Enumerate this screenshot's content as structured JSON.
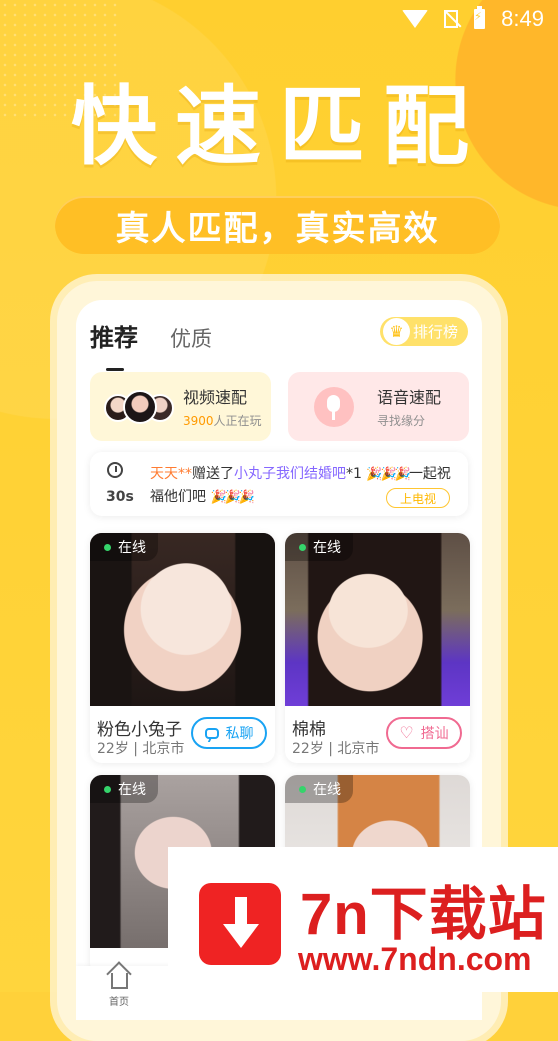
{
  "status_bar": {
    "time": "8:49",
    "wifi_icon": "wifi-icon",
    "sim_icon": "no-sim-icon",
    "battery_icon": "battery-charging-icon"
  },
  "hero": {
    "title": "快速匹配",
    "subtitle": "真人匹配，真实高效"
  },
  "tabs": [
    {
      "label": "推荐",
      "active": true
    },
    {
      "label": "优质",
      "active": false
    }
  ],
  "rank_button": {
    "label": "排行榜",
    "icon": "trophy-icon"
  },
  "match_cards": [
    {
      "title": "视频速配",
      "highlight": "3900",
      "subtitle": "人正在玩",
      "icon": "avatar-group-icon"
    },
    {
      "title": "语音速配",
      "subtitle": "寻找缘分",
      "icon": "microphone-icon"
    }
  ],
  "gift_notice": {
    "timer": "30s",
    "name": "天天**",
    "sent": "赠送了",
    "recipient": "小丸子我们结婚吧",
    "count": "*1",
    "party": "🎉🎉🎉",
    "end": "一起祝",
    "line2_text": "福他们吧",
    "line2_party": "🎉🎉🎉",
    "button": "上电视"
  },
  "users": [
    {
      "name": "粉色小兔子",
      "meta": "22岁 | 北京市",
      "status": "在线",
      "button": "私聊",
      "button_icon": "chat-icon"
    },
    {
      "name": "棉棉",
      "meta": "22岁 | 北京市",
      "status": "在线",
      "button": "搭讪",
      "button_icon": "heart-icon"
    },
    {
      "name": "",
      "meta": "",
      "status": "在线",
      "button": "",
      "button_icon": ""
    },
    {
      "name": "",
      "meta": "",
      "status": "在线",
      "button": "",
      "button_icon": ""
    }
  ],
  "bottom_nav": {
    "home_label": "首页",
    "home_icon": "home-icon"
  },
  "watermark": {
    "title": "7n下载站",
    "url": "www.7ndn.com",
    "icon": "download-icon"
  },
  "colors": {
    "background": "#ffd13a",
    "accent_orange": "#ff9a00",
    "chat_blue": "#19a3f3",
    "greet_pink": "#f06a91",
    "watermark_red": "#dc1f1f"
  }
}
